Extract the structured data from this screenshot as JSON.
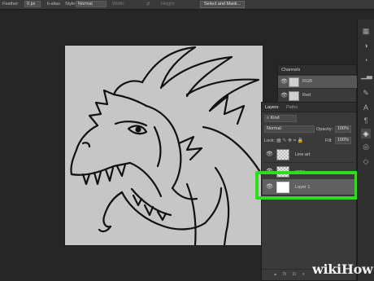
{
  "options_bar": {
    "width_value": "0 px",
    "no_align_label": "ti-alias",
    "style_label": "Style:",
    "style_value": "Normal",
    "width_label": "Width:",
    "height_label": "Height:",
    "select_mask_label": "Select and Mask..."
  },
  "tools": [
    "swatches-icon",
    "adjustments-icon",
    "text-icon",
    "paragraph-icon",
    "layers-icon",
    "channels-icon",
    "paths-icon"
  ],
  "channels_panel": {
    "tab_label": "Channels",
    "rows": [
      {
        "name": "RGB",
        "selected": true
      },
      {
        "name": "Red",
        "selected": false
      }
    ]
  },
  "layers_panel": {
    "tabs": [
      "Layers",
      "Paths"
    ],
    "filter_label": "Kind",
    "blend_mode": "Normal",
    "opacity_label": "Opacity:",
    "opacity_value": "100%",
    "lock_label": "Lock:",
    "fill_label": "Fill:",
    "fill_value": "100%",
    "layers": [
      {
        "name": "Line art",
        "selected": false
      },
      {
        "name": "copy",
        "selected": false
      },
      {
        "name": "Layer 1",
        "selected": true
      }
    ],
    "footer_fx": "fx"
  },
  "highlight_color": "#2ddc1b",
  "watermark": {
    "part1": "wiki",
    "part2": "How"
  }
}
